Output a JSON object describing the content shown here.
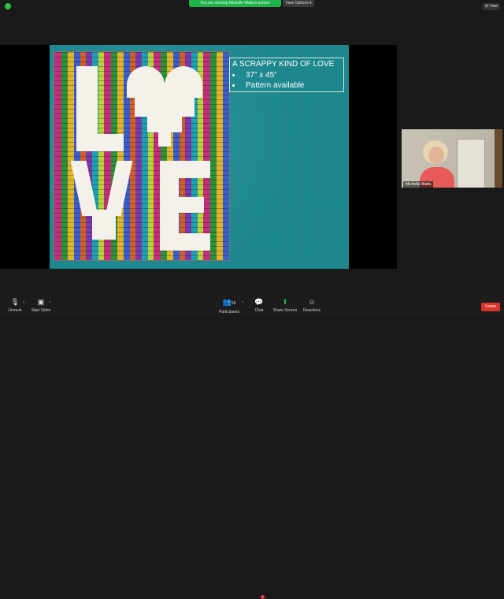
{
  "top": {
    "banner_text": "You are viewing Michelle Watts's screen",
    "view_options": "View Options ▾",
    "view_button": "⊞ View"
  },
  "slide": {
    "title": "A SCRAPPY KIND OF LOVE",
    "bullets": [
      "37” x 45”",
      "Pattern available"
    ]
  },
  "participant": {
    "name": "Michelle Watts"
  },
  "toolbar": {
    "unmute": "Unmute",
    "start_video": "Start Video",
    "participants": "Participants",
    "participants_count": "66",
    "chat": "Chat",
    "share_screen": "Share Screen",
    "reactions": "Reactions",
    "leave": "Leave"
  },
  "colors": {
    "share_green": "#22b24c",
    "slide_teal": "#1f8e96",
    "leave_red": "#d9342b"
  }
}
